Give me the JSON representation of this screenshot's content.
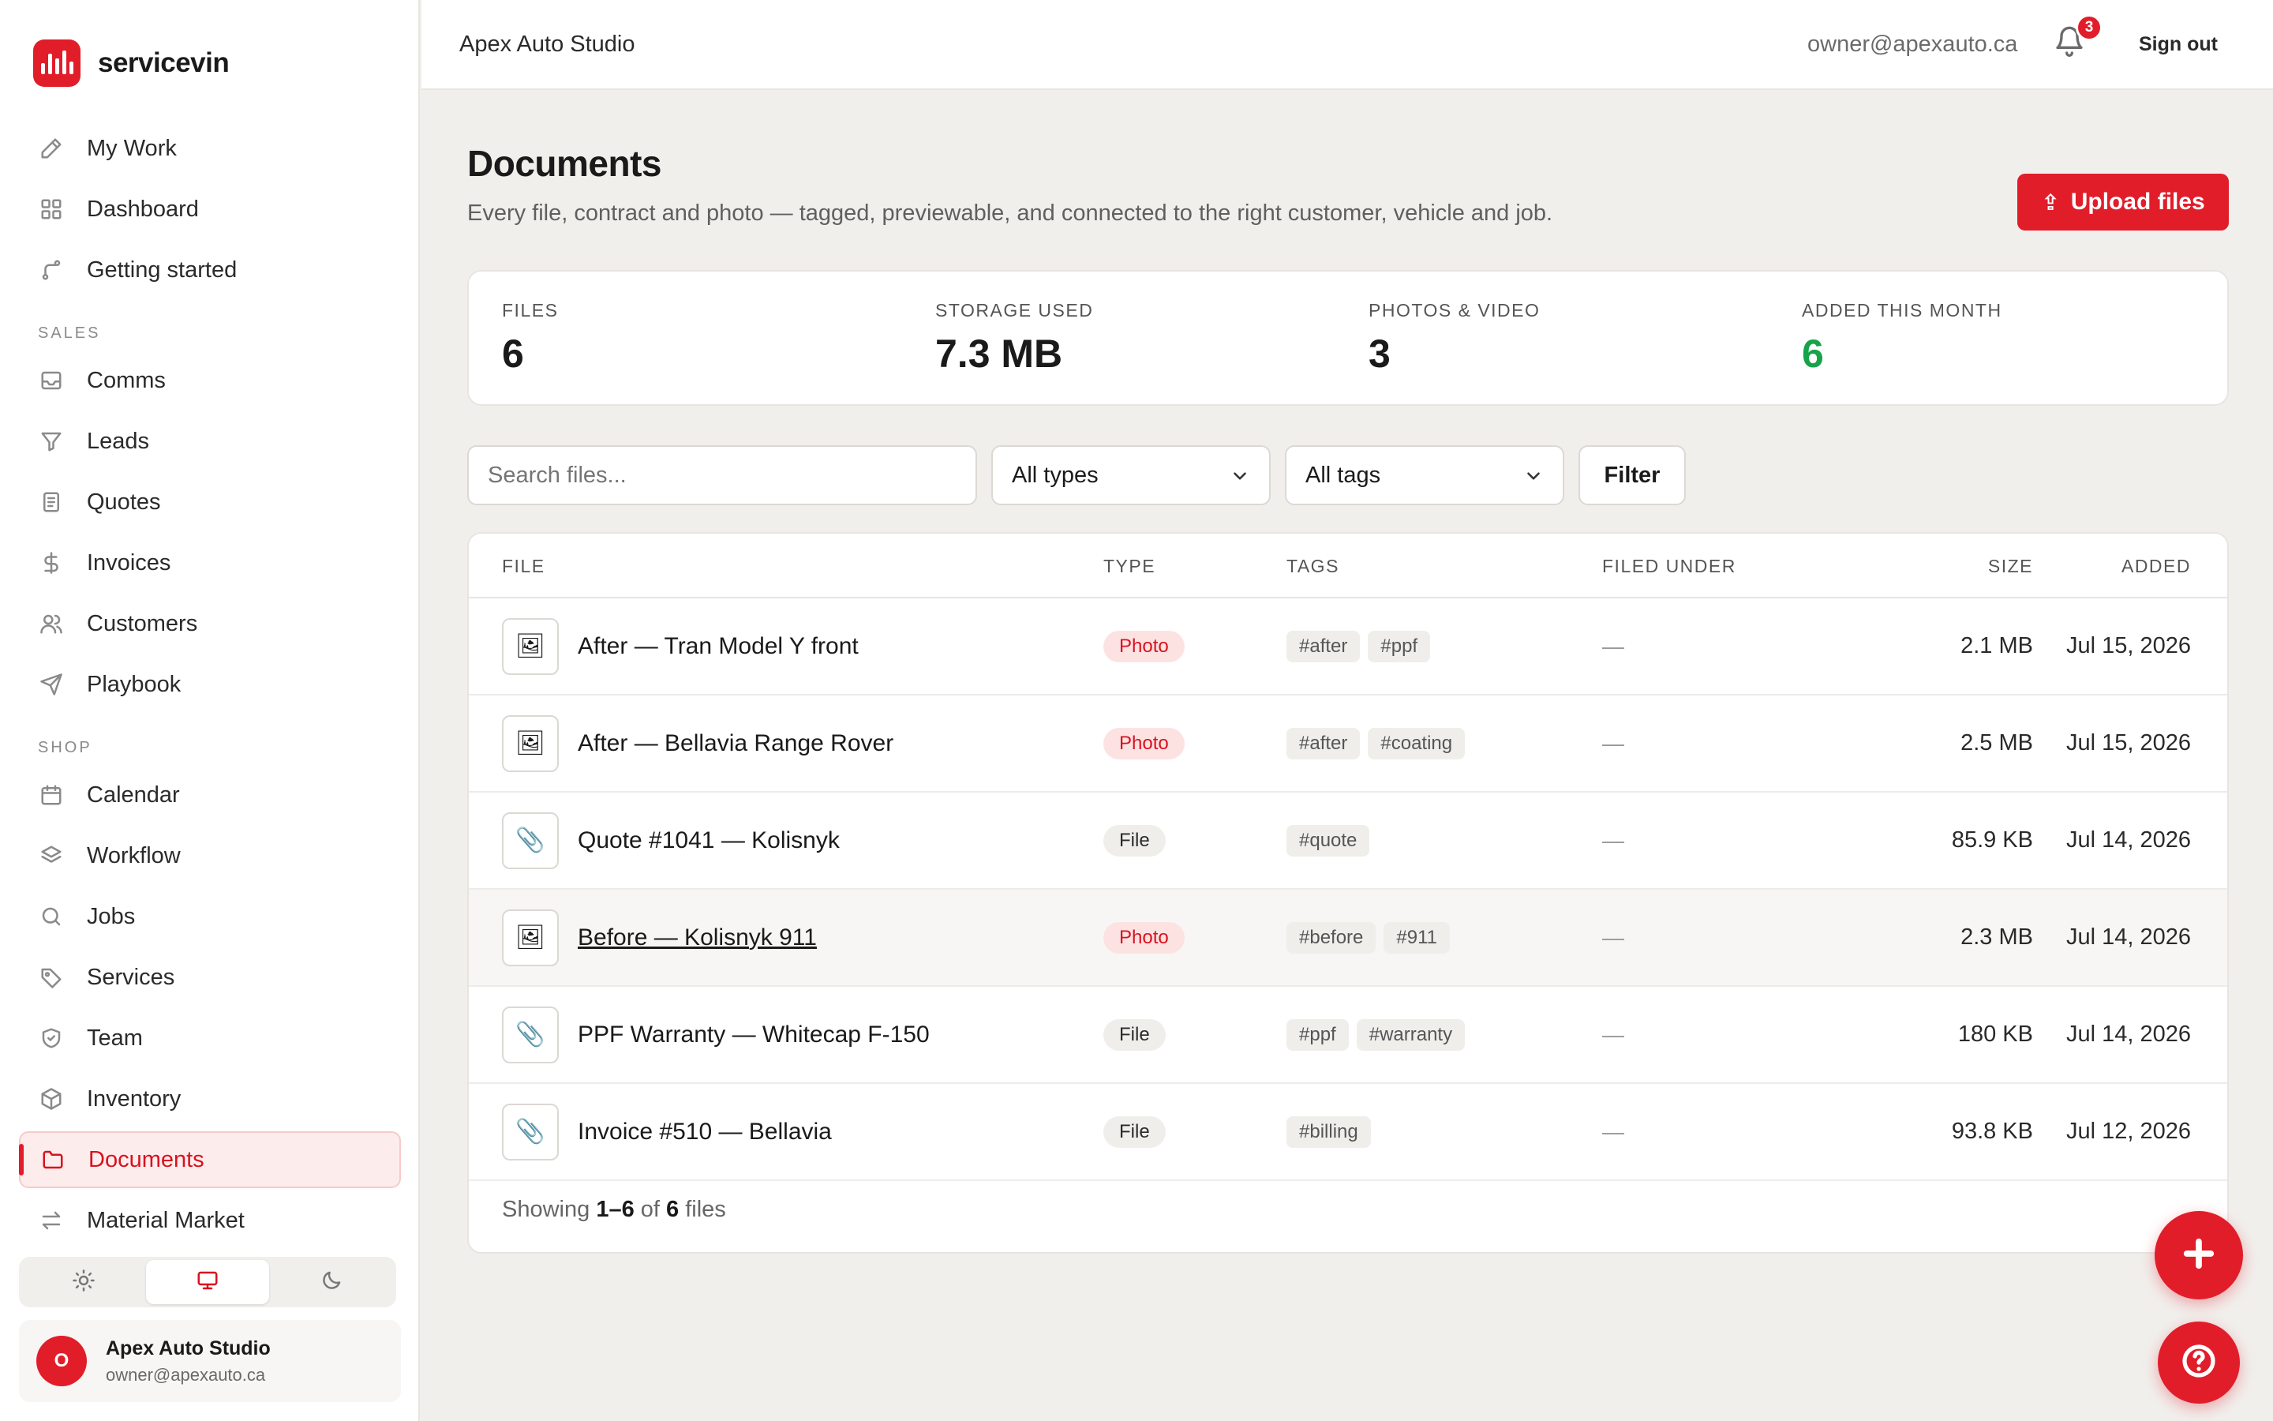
{
  "brand": {
    "name": "servicevin"
  },
  "nav": {
    "main": [
      {
        "label": "My Work",
        "icon": "pen-icon"
      },
      {
        "label": "Dashboard",
        "icon": "grid-icon"
      },
      {
        "label": "Getting started",
        "icon": "route-icon"
      }
    ],
    "sales_title": "SALES",
    "sales": [
      {
        "label": "Comms",
        "icon": "inbox-icon"
      },
      {
        "label": "Leads",
        "icon": "funnel-icon"
      },
      {
        "label": "Quotes",
        "icon": "document-icon"
      },
      {
        "label": "Invoices",
        "icon": "dollar-icon"
      },
      {
        "label": "Customers",
        "icon": "users-icon"
      },
      {
        "label": "Playbook",
        "icon": "send-icon"
      }
    ],
    "shop_title": "SHOP",
    "shop": [
      {
        "label": "Calendar",
        "icon": "calendar-icon"
      },
      {
        "label": "Workflow",
        "icon": "layers-icon"
      },
      {
        "label": "Jobs",
        "icon": "search-icon"
      },
      {
        "label": "Services",
        "icon": "tag-icon"
      },
      {
        "label": "Team",
        "icon": "shield-icon"
      },
      {
        "label": "Inventory",
        "icon": "box-icon"
      },
      {
        "label": "Documents",
        "icon": "folder-icon",
        "active": true
      },
      {
        "label": "Material Market",
        "icon": "arrows-icon"
      }
    ]
  },
  "theme": {
    "options": [
      "sun-icon",
      "monitor-icon",
      "moon-icon"
    ],
    "selected": "monitor-icon"
  },
  "profile": {
    "initial": "O",
    "name": "Apex Auto Studio",
    "email": "owner@apexauto.ca"
  },
  "topbar": {
    "org": "Apex Auto Studio",
    "email": "owner@apexauto.ca",
    "notifications": "3",
    "signout": "Sign out"
  },
  "page": {
    "title": "Documents",
    "subtitle": "Every file, contract and photo — tagged, previewable, and connected to the right customer, vehicle and job.",
    "upload_icon": "⇪",
    "upload_label": "Upload files"
  },
  "stats": [
    {
      "label": "FILES",
      "value": "6"
    },
    {
      "label": "STORAGE USED",
      "value": "7.3 MB"
    },
    {
      "label": "PHOTOS & VIDEO",
      "value": "3"
    },
    {
      "label": "ADDED THIS MONTH",
      "value": "6",
      "color": "#16a34a"
    }
  ],
  "filters": {
    "search_placeholder": "Search files...",
    "type": "All types",
    "tags": "All tags",
    "filter_label": "Filter"
  },
  "table": {
    "headers": {
      "file": "FILE",
      "type": "TYPE",
      "tags": "TAGS",
      "filed_under": "FILED UNDER",
      "size": "SIZE",
      "added": "ADDED"
    },
    "rows": [
      {
        "icon": "🖼",
        "name": "After — Tran Model Y front",
        "type": "Photo",
        "tags": [
          "#after",
          "#ppf"
        ],
        "filed": "—",
        "size": "2.1 MB",
        "added": "Jul 15, 2026"
      },
      {
        "icon": "🖼",
        "name": "After — Bellavia Range Rover",
        "type": "Photo",
        "tags": [
          "#after",
          "#coating"
        ],
        "filed": "—",
        "size": "2.5 MB",
        "added": "Jul 15, 2026"
      },
      {
        "icon": "📎",
        "name": "Quote #1041 — Kolisnyk",
        "type": "File",
        "tags": [
          "#quote"
        ],
        "filed": "—",
        "size": "85.9 KB",
        "added": "Jul 14, 2026"
      },
      {
        "icon": "🖼",
        "name": "Before — Kolisnyk 911",
        "type": "Photo",
        "tags": [
          "#before",
          "#911"
        ],
        "filed": "—",
        "size": "2.3 MB",
        "added": "Jul 14, 2026"
      },
      {
        "icon": "📎",
        "name": "PPF Warranty — Whitecap F-150",
        "type": "File",
        "tags": [
          "#ppf",
          "#warranty"
        ],
        "filed": "—",
        "size": "180 KB",
        "added": "Jul 14, 2026"
      },
      {
        "icon": "📎",
        "name": "Invoice #510 — Bellavia",
        "type": "File",
        "tags": [
          "#billing"
        ],
        "filed": "—",
        "size": "93.8 KB",
        "added": "Jul 12, 2026"
      }
    ],
    "footer": {
      "prefix": "Showing",
      "range": "1–6",
      "of": "of",
      "total": "6",
      "suffix": "files"
    }
  },
  "colors": {
    "accent": "#e11d2a",
    "success": "#16a34a"
  }
}
